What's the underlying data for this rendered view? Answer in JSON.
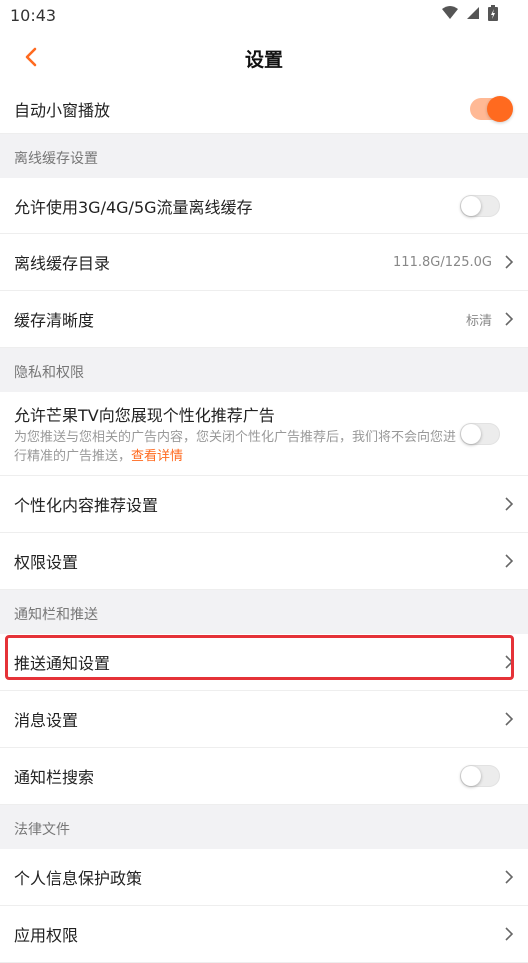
{
  "status_bar": {
    "time": "10:43"
  },
  "nav": {
    "title": "设置"
  },
  "rows": {
    "auto_pip": {
      "label": "自动小窗播放",
      "toggle": true
    },
    "offline_section": "离线缓存设置",
    "allow_mobile_cache": {
      "label": "允许使用3G/4G/5G流量离线缓存",
      "toggle": false
    },
    "cache_dir": {
      "label": "离线缓存目录",
      "value": "111.8G/125.0G"
    },
    "cache_quality": {
      "label": "缓存清晰度",
      "value": "标清"
    },
    "privacy_section": "隐私和权限",
    "personalized_ads": {
      "label": "允许芒果TV向您展现个性化推荐广告",
      "desc": "为您推送与您相关的广告内容，您关闭个性化广告推荐后，我们将不会向您进行精准的广告推送，",
      "link": "查看详情",
      "toggle": false
    },
    "personalized_content": {
      "label": "个性化内容推荐设置"
    },
    "permissions": {
      "label": "权限设置"
    },
    "notify_section": "通知栏和推送",
    "push_settings": {
      "label": "推送通知设置"
    },
    "message_settings": {
      "label": "消息设置"
    },
    "notify_search": {
      "label": "通知栏搜索",
      "toggle": false
    },
    "legal_section": "法律文件",
    "privacy_policy": {
      "label": "个人信息保护政策"
    },
    "app_permissions": {
      "label": "应用权限"
    }
  },
  "colors": {
    "accent": "#ff6a1f",
    "highlight": "#e53238"
  }
}
